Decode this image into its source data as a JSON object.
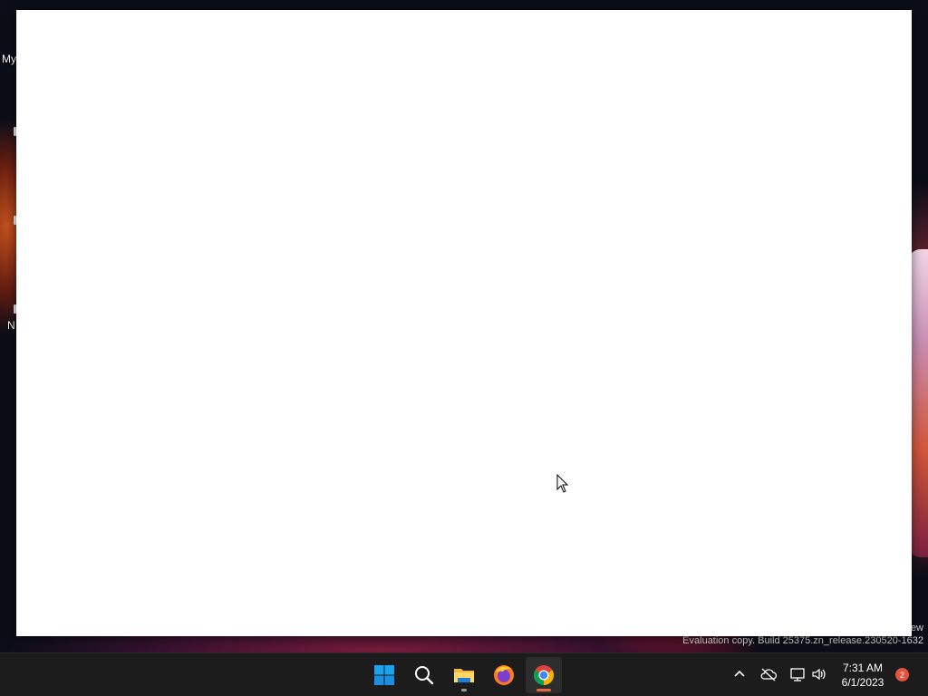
{
  "desktop": {
    "icons": [
      {
        "label": "My"
      },
      {
        "label": "N"
      }
    ]
  },
  "watermark": {
    "line1": "ew",
    "line2": "Evaluation copy. Build 25375.zn_release.230520-1632"
  },
  "taskbar": {
    "apps": [
      {
        "name": "start-icon"
      },
      {
        "name": "search-icon"
      },
      {
        "name": "file-explorer-icon"
      },
      {
        "name": "firefox-icon"
      },
      {
        "name": "chrome-icon"
      }
    ],
    "tray": {
      "time": "7:31 AM",
      "date": "6/1/2023",
      "notification_count": "2"
    }
  },
  "colors": {
    "taskbar": "#1c1c1c",
    "window": "#ffffff",
    "accent_indicator": "#e06a3c",
    "explorer_indicator": "#9a9a9a"
  }
}
